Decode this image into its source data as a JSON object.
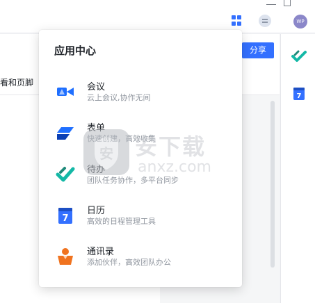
{
  "titlebar": {
    "avatar_initials": "WP",
    "icons": [
      "app-grid-icon",
      "chat-icon",
      "minimize-icon",
      "maximize-icon"
    ]
  },
  "document": {
    "toolbar_text": "看和页脚",
    "share_label": "分享"
  },
  "popup": {
    "title": "应用中心",
    "apps": [
      {
        "name": "会议",
        "desc": "云上会议,协作无间",
        "icon": "meeting-camera-icon"
      },
      {
        "name": "表单",
        "desc": "快速创建，高效收集",
        "icon": "form-icon"
      },
      {
        "name": "待办",
        "desc": "团队任务协作，多平台同步",
        "icon": "todo-check-icon"
      },
      {
        "name": "日历",
        "desc": "高效的日程管理工具",
        "icon": "calendar-icon"
      },
      {
        "name": "通讯录",
        "desc": "添加伙伴，高效团队办公",
        "icon": "contacts-icon"
      }
    ]
  },
  "right_rail": {
    "icons": [
      "todo-check-icon",
      "calendar-icon"
    ],
    "calendar_day": "7"
  },
  "watermark": {
    "cn": "安下载",
    "en": "anxz.com"
  },
  "colors": {
    "accent": "#3370ff",
    "todo_green": "#14b8a6",
    "contacts_orange": "#f0731f"
  }
}
